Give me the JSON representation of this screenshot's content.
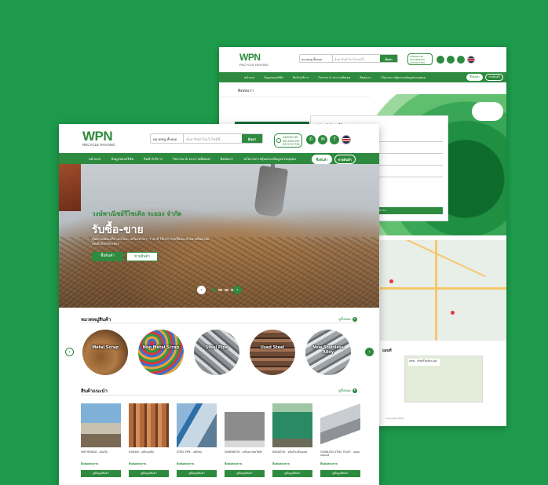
{
  "brand": {
    "logo_main": "WPN",
    "logo_sub": "RECYCLE RAYONG"
  },
  "search": {
    "category": "หมวดหมู่ ทั้งหมด",
    "placeholder": "ค้นหาสินค้าในเว็บไซต์นี้...",
    "button": "ค้นหา"
  },
  "phones": [
    "038000738",
    "0614899165",
    "0970757758"
  ],
  "socials": [
    "line-icon",
    "email-icon",
    "facebook-icon",
    "thai-flag-icon"
  ],
  "nav": {
    "items": [
      "หน้าแรก",
      "ข้อมูลของบริษัท",
      "สินค้า/บริการ",
      "กิจกรรม & ประกาศอัพเดท",
      "ติดต่อเรา",
      "นโยบายการคุ้มครองข้อมูลส่วนบุคคล"
    ],
    "buy_label": "ซื้อสินค้า",
    "sell_label": "ขายสินค้า"
  },
  "front": {
    "hero": {
      "company": "วงษ์พาณิชย์รีไซเคิล ระยอง จำกัด",
      "headline": "รับซื้อ-ขาย",
      "description": "ศูนย์รวมเศษเหล็ก เศษโลหะ เครื่องจักรเก่า ราคาดี ให้บริการรับซื้อและจำหน่ายสินค้ามือสองทั่วจังหวัดระยอง",
      "buy_button": "ซื้อสินค้า",
      "sell_button": "ขายสินค้า"
    },
    "categories": {
      "title": "หมวดหมู่สินค้า",
      "see_all": "ดูทั้งหมด",
      "items": [
        {
          "label": "Metal Scrap"
        },
        {
          "label": "Non Metal Scrap"
        },
        {
          "label": "Steel Pipe"
        },
        {
          "label": "Used Steel"
        },
        {
          "label": "New Stainless Alloy"
        }
      ]
    },
    "recommended": {
      "title": "สินค้าแนะนำ",
      "see_all": "ดูทั้งหมด",
      "items": [
        {
          "name": "SHIP BRIDGE - ห้องเรือ",
          "price": "ติดต่อสอบถาม",
          "button": "ดูข้อมูลสินค้า"
        },
        {
          "name": "H-BEAM - เหล็กเอชบีม",
          "price": "ติดต่อสอบถาม",
          "button": "ดูข้อมูลสินค้า"
        },
        {
          "name": "STEEL PIPE - เหล็กท่อ",
          "price": "ติดต่อสอบถาม",
          "button": "ดูข้อมูลสินค้า"
        },
        {
          "name": "GENERATOR - เครื่องกำเนิดไฟฟ้า",
          "price": "ติดต่อสอบถาม",
          "button": "ดูข้อมูลสินค้า"
        },
        {
          "name": "RADIATOR - หม้อน้ำเครื่องยนต์",
          "price": "ติดต่อสอบถาม",
          "button": "ดูข้อมูลสินค้า"
        },
        {
          "name": "STAINLESS STEEL PLATE - แผ่นสแตนเลส",
          "price": "ติดต่อสอบถาม",
          "button": "ดูข้อมูลสินค้า"
        }
      ]
    }
  },
  "back": {
    "breadcrumb": "ติดต่อเรา",
    "form": {
      "title": "ฝากข้อความ",
      "subtitle": "บริษัท แจ้งข้อมูลที่ต้องการติดต่อ",
      "fields": [
        "ชื่อ",
        "อีเมล",
        "หัวข้อที่ต้องการติดต่อ",
        "ข้อความ"
      ],
      "submit": "ส่งข้อความ"
    },
    "map": {
      "place": "วงษ์พาณิชย์ รีไซเคิล ระยอง"
    },
    "address": {
      "title": "แผนที่",
      "company": "WPN - บริษัทรีไซเคิลระยอง",
      "footer": "Copyright 2024"
    }
  },
  "colors": {
    "brand_green": "#2e8a3e",
    "background": "#1d9a4b"
  }
}
